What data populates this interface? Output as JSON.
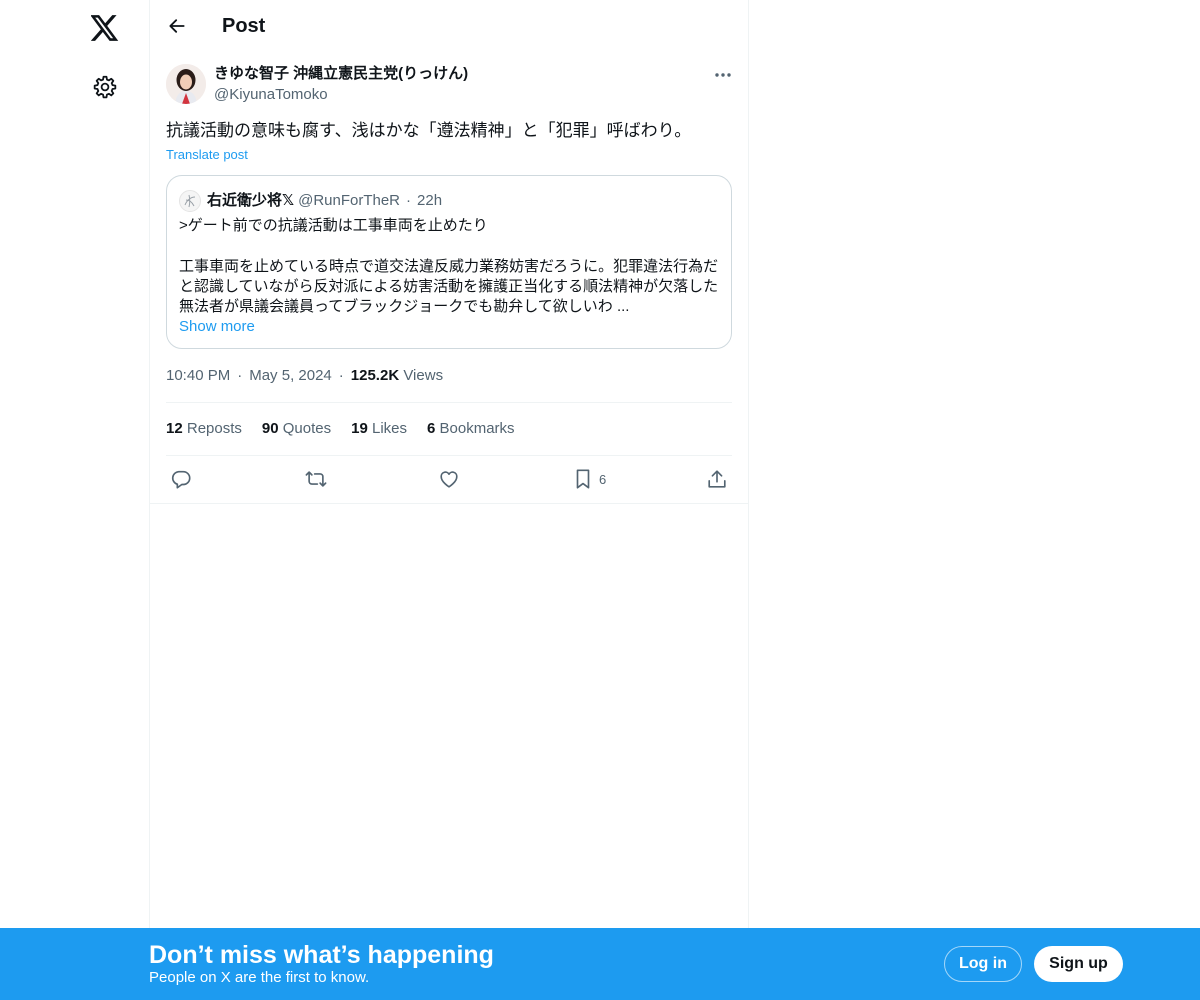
{
  "colors": {
    "accent": "#1d9bf0",
    "text_primary": "#0f1419",
    "text_secondary": "#536471",
    "border": "#cfd9de",
    "bottom_bar": "#1d9bf0"
  },
  "nav": {
    "logo_icon": "x-logo-icon",
    "settings_icon": "gear-icon"
  },
  "header": {
    "back_icon": "arrow-left-icon",
    "title": "Post"
  },
  "post": {
    "author_name": "きゆな智子 沖縄立憲民主党(りっけん)",
    "author_handle": "@KiyunaTomoko",
    "more_icon": "ellipsis-icon",
    "text": "抗議活動の意味も腐す、浅はかな「遵法精神」と「犯罪」呼ばわり。",
    "translate_label": "Translate post",
    "quote": {
      "author_name": "右近衛少将𝕏",
      "author_handle": "@RunForTheR",
      "dot": "·",
      "time": "22h",
      "line1": ">ゲート前での抗議活動は工事車両を止めたり",
      "line2": "工事車両を止めている時点で道交法違反威力業務妨害だろうに。犯罪違法行為だ",
      "line3": "と認識していながら反対派による妨害活動を擁護正当化する順法精神が欠落した",
      "line4": "無法者が県議会議員ってブラックジョークでも勘弁して欲しいわ ...",
      "show_more": "Show more"
    },
    "time": "10:40 PM",
    "sep": "·",
    "date": "May 5, 2024",
    "views_count": "125.2K",
    "views_label": "Views",
    "stats": {
      "reposts_count": "12",
      "reposts_label": "Reposts",
      "quotes_count": "90",
      "quotes_label": "Quotes",
      "likes_count": "19",
      "likes_label": "Likes",
      "bookmarks_count": "6",
      "bookmarks_label": "Bookmarks"
    },
    "actions": {
      "reply_icon": "reply-icon",
      "repost_icon": "repost-icon",
      "like_icon": "heart-icon",
      "bookmark_icon": "bookmark-icon",
      "bookmark_count": "6",
      "share_icon": "share-icon"
    }
  },
  "bottom_bar": {
    "title": "Don’t miss what’s happening",
    "subtitle": "People on X are the first to know.",
    "login_label": "Log in",
    "signup_label": "Sign up"
  }
}
